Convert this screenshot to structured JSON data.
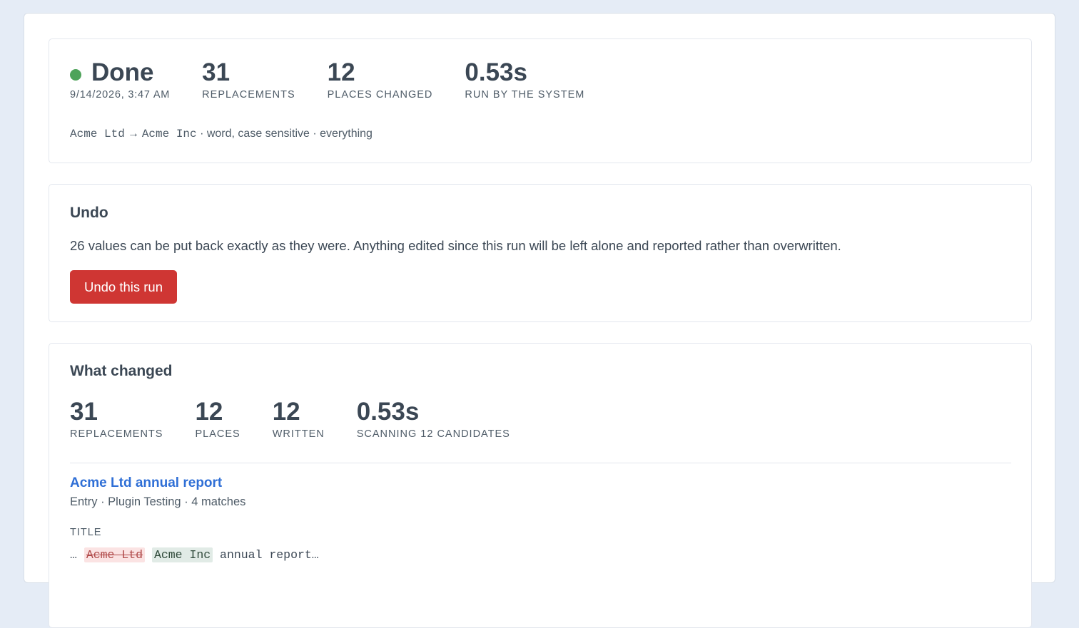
{
  "summary": {
    "status": "Done",
    "status_color": "#4ea35a",
    "timestamp": "9/14/2026, 3:47 AM",
    "replacements_value": "31",
    "replacements_label": "Replacements",
    "places_changed_value": "12",
    "places_changed_label": "Places changed",
    "duration_value": "0.53s",
    "run_by_label": "Run by the system",
    "rule": {
      "find": "Acme Ltd",
      "arrow": "→",
      "replace": "Acme Inc",
      "options": "· word, case sensitive · everything"
    }
  },
  "undo": {
    "title": "Undo",
    "description": "26 values can be put back exactly as they were. Anything edited since this run will be left alone and reported rather than overwritten.",
    "button_label": "Undo this run",
    "button_color": "#cf3633"
  },
  "changes": {
    "title": "What changed",
    "stats": [
      {
        "value": "31",
        "label": "Replacements"
      },
      {
        "value": "12",
        "label": "Places"
      },
      {
        "value": "12",
        "label": "Written"
      },
      {
        "value": "0.53s",
        "label": "Scanning 12 candidates"
      }
    ],
    "entries": [
      {
        "title": "Acme Ltd annual report",
        "meta": "Entry · Plugin Testing · 4 matches",
        "field_label": "TITLE",
        "diff": {
          "prefix": "… ",
          "removed": "Acme Ltd",
          "added": "Acme Inc",
          "suffix": " annual report…"
        }
      }
    ]
  },
  "colors": {
    "page_background": "#e5ecf6",
    "link": "#2f6fd6",
    "deleted_background": "#fbe3e3",
    "inserted_background": "#e1ebe6"
  }
}
